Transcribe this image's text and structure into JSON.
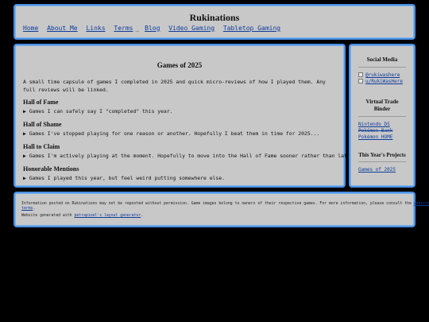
{
  "header": {
    "title": "Rukinations",
    "nav": [
      "Home",
      "About Me",
      "Links",
      "Terms",
      "Blog",
      "Video Gaming",
      "Tabletop Gaming"
    ],
    "separator": "_"
  },
  "main": {
    "title": "Games of 2025",
    "intro": "A small time capsule of games I completed in 2025 and quick micro-reviews of how I played them. Any full reviews will be linked.",
    "sections": [
      {
        "heading": "Hall of Fame",
        "desc": "▶ Games I can safely say I \"completed\" this year."
      },
      {
        "heading": "Hall of Shame",
        "desc": "▶ Games I've stopped playing for one reason or another. Hopefully I beat them in time for 2025..."
      },
      {
        "heading": "Hall to Claim",
        "desc": "▶ Games I'm actively playing at the moment. Hopefully to move into the Hall of Fame sooner rather than later."
      },
      {
        "heading": "Honorable Mentions",
        "desc": "▶ Games I played this year, but feel weird putting somewhere else."
      }
    ]
  },
  "sidebar": {
    "social_title": "Social Media",
    "social_links": [
      "@rukiwashere",
      "u/RukiWasHere"
    ],
    "binder_title_1": "Virtual Trade",
    "binder_title_2": "Binder",
    "binder_links": [
      "Nintendo DS",
      "Pokémon Bank",
      "Pokémon HOME"
    ],
    "projects_title": "This Year's Projects",
    "projects_links": [
      "Games of 2025"
    ]
  },
  "footer": {
    "notice_pre": "Information posted on Rukinations may not be reposted without permission. Game images belong to owners of their respective games. For more information, please consult the",
    "notice_link_1": "website",
    "notice_link_2": "terms",
    "notice_post": ".",
    "generated_pre": "Website generated with",
    "generated_link": "petrapixel's layout generator",
    "generated_post": "."
  }
}
